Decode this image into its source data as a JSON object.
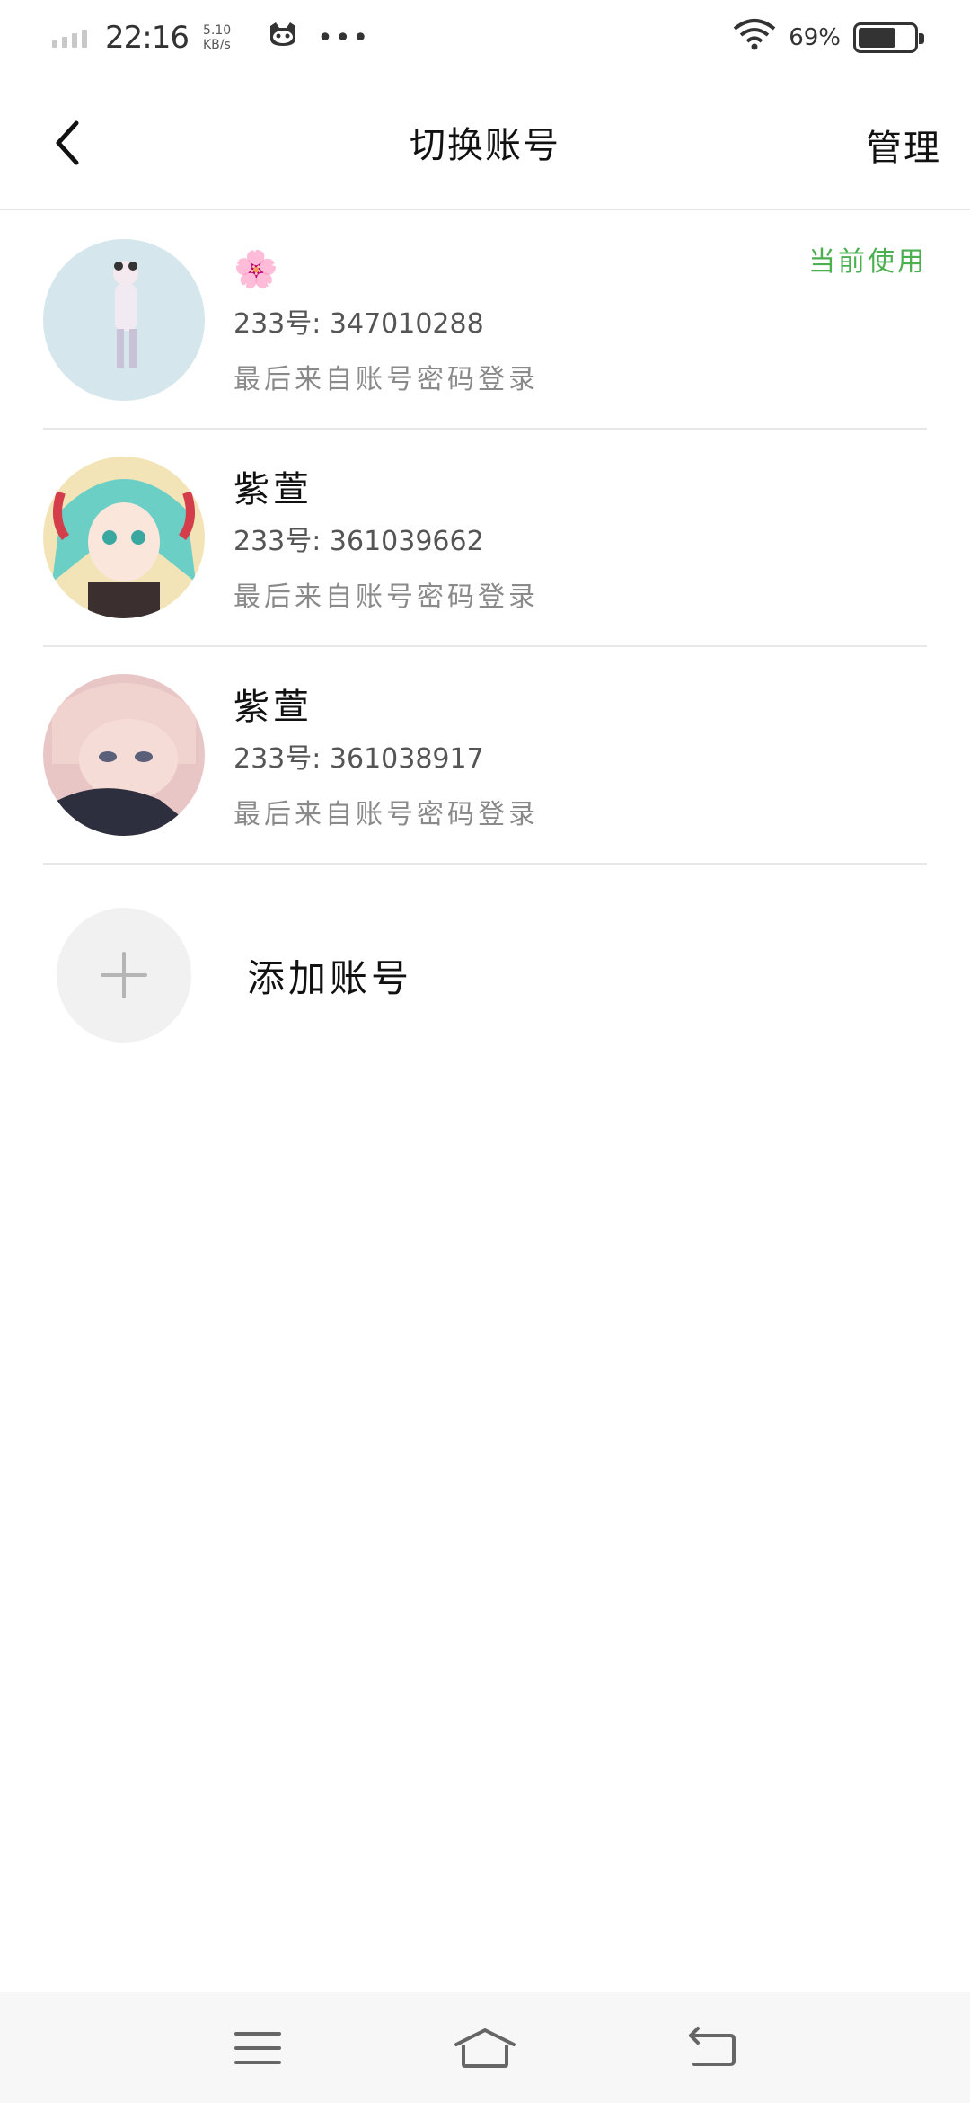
{
  "status_bar": {
    "time": "22:16",
    "net_speed_value": "5.10",
    "net_speed_unit": "KB/s",
    "battery_percent": "69%",
    "battery_level": 0.69,
    "icons": [
      "signal-icon",
      "cat-icon",
      "more-dots-icon",
      "wifi-icon",
      "battery-icon"
    ]
  },
  "header": {
    "title": "切换账号",
    "manage_label": "管理",
    "back_icon": "chevron-left-icon"
  },
  "accounts": [
    {
      "name": "🌸",
      "id_text": "233号: 347010288",
      "login_text": "最后来自账号密码登录",
      "current_label": "当前使用"
    },
    {
      "name": "紫萱",
      "id_text": "233号: 361039662",
      "login_text": "最后来自账号密码登录"
    },
    {
      "name": "紫萱",
      "id_text": "233号: 361038917",
      "login_text": "最后来自账号密码登录"
    }
  ],
  "add_account": {
    "label": "添加账号",
    "icon": "plus-icon"
  },
  "nav_bar": {
    "icons": [
      "menu-icon",
      "home-icon",
      "back-icon"
    ]
  },
  "colors": {
    "accent_green": "#4caf50",
    "divider": "#e8e8e8",
    "secondary_text": "#8a8a8a"
  }
}
